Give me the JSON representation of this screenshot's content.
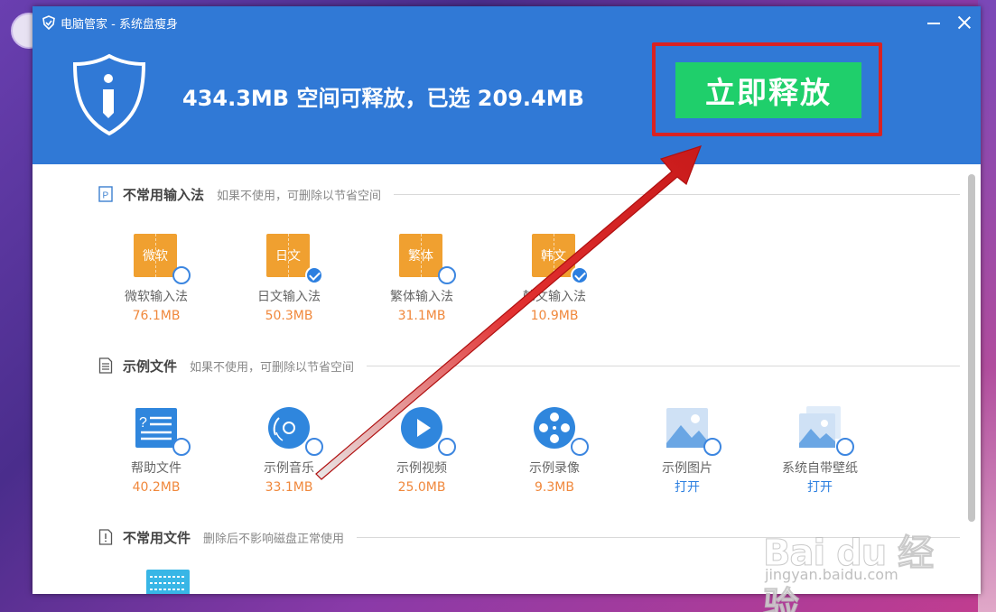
{
  "window": {
    "title": "电脑管家 - 系统盘瘦身"
  },
  "header": {
    "summary": "434.3MB 空间可释放，已选 209.4MB",
    "release_label": "立即释放"
  },
  "sections": [
    {
      "title": "不常用输入法",
      "desc": "如果不使用，可删除以节省空间",
      "items": [
        {
          "icon_text": "微软",
          "label": "微软输入法",
          "size": "76.1MB",
          "checked": false
        },
        {
          "icon_text": "日文",
          "label": "日文输入法",
          "size": "50.3MB",
          "checked": true
        },
        {
          "icon_text": "繁体",
          "label": "繁体输入法",
          "size": "31.1MB",
          "checked": false
        },
        {
          "icon_text": "韩文",
          "label": "韩文输入法",
          "size": "10.9MB",
          "checked": true
        }
      ]
    },
    {
      "title": "示例文件",
      "desc": "如果不使用，可删除以节省空间",
      "items": [
        {
          "icon": "help-document-icon",
          "label": "帮助文件",
          "size": "40.2MB",
          "checked": false
        },
        {
          "icon": "music-disc-icon",
          "label": "示例音乐",
          "size": "33.1MB",
          "checked": false
        },
        {
          "icon": "video-play-icon",
          "label": "示例视频",
          "size": "25.0MB",
          "checked": false
        },
        {
          "icon": "film-reel-icon",
          "label": "示例录像",
          "size": "9.3MB",
          "checked": false
        },
        {
          "icon": "image-icon",
          "label": "示例图片",
          "action": "打开",
          "checked": false
        },
        {
          "icon": "wallpaper-icon",
          "label": "系统自带壁纸",
          "action": "打开",
          "checked": false
        }
      ]
    },
    {
      "title": "不常用文件",
      "desc": "删除后不影响磁盘正常使用"
    }
  ],
  "watermark": {
    "brand": "Bai du 经验",
    "url": "jingyan.baidu.com"
  },
  "colors": {
    "header_blue": "#3079d6",
    "release_green": "#1fcf6b",
    "highlight_red": "#d92222",
    "size_orange": "#f0883c",
    "link_blue": "#2c7fe0"
  }
}
